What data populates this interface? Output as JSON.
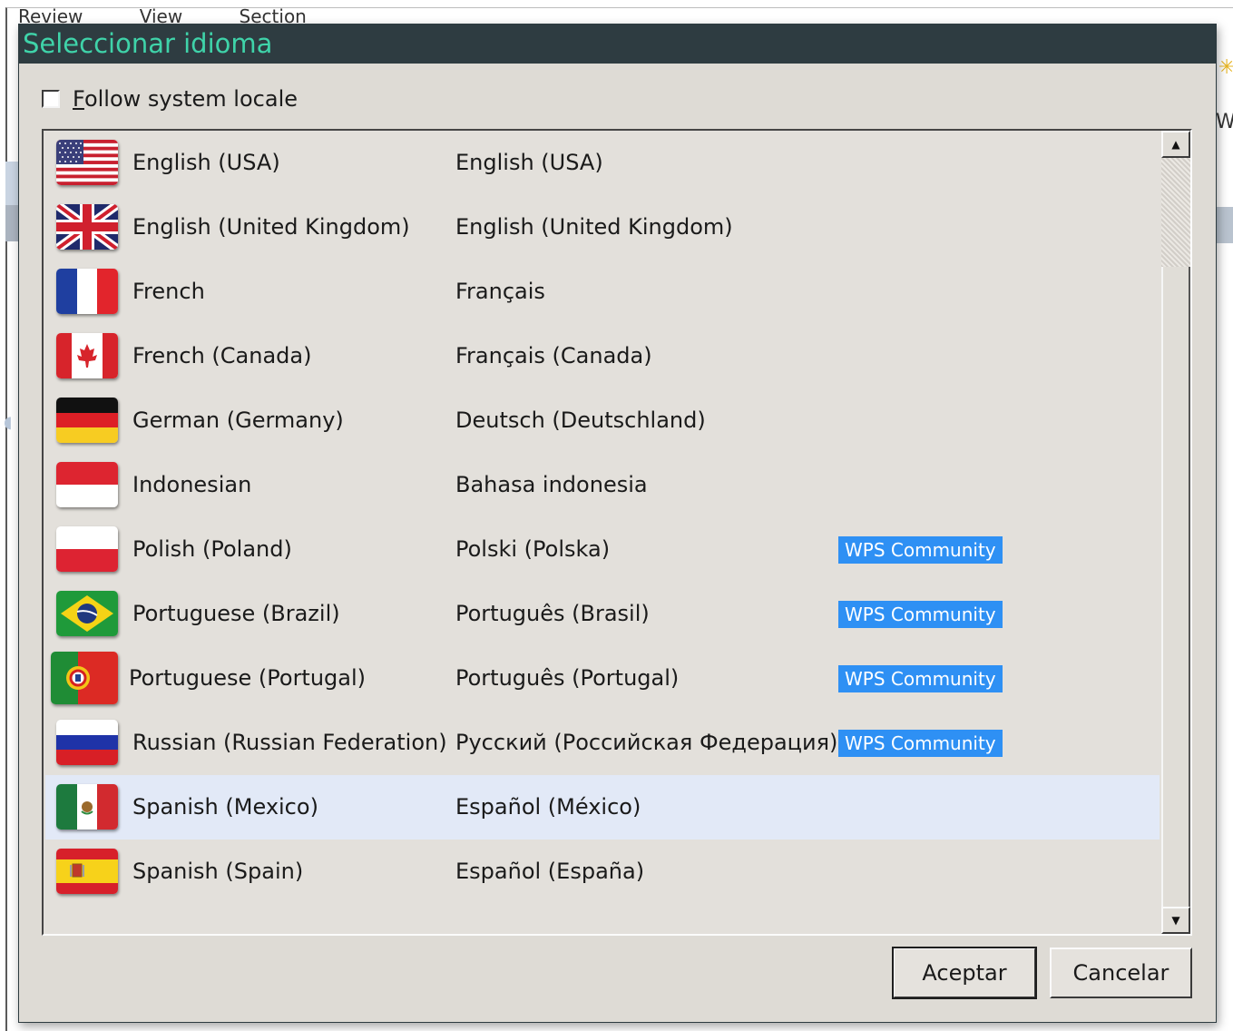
{
  "background": {
    "menu": [
      "Review",
      "View",
      "Section"
    ],
    "right_letter": "W"
  },
  "dialog": {
    "title": "Seleccionar idioma",
    "follow_locale": {
      "label_key": "F",
      "label_rest": "ollow system locale",
      "checked": false
    },
    "languages": [
      {
        "flag": "flag-usa-icon",
        "english_name": "English (USA)",
        "native_name": "English (USA)",
        "badge": ""
      },
      {
        "flag": "flag-uk-icon",
        "english_name": "English (United Kingdom)",
        "native_name": "English (United Kingdom)",
        "badge": ""
      },
      {
        "flag": "flag-france-icon",
        "english_name": "French",
        "native_name": "Français",
        "badge": ""
      },
      {
        "flag": "flag-canada-icon",
        "english_name": "French (Canada)",
        "native_name": "Français (Canada)",
        "badge": ""
      },
      {
        "flag": "flag-germany-icon",
        "english_name": "German (Germany)",
        "native_name": "Deutsch (Deutschland)",
        "badge": ""
      },
      {
        "flag": "flag-indonesia-icon",
        "english_name": "Indonesian",
        "native_name": "Bahasa indonesia",
        "badge": ""
      },
      {
        "flag": "flag-poland-icon",
        "english_name": "Polish (Poland)",
        "native_name": "Polski (Polska)",
        "badge": "WPS Community"
      },
      {
        "flag": "flag-brazil-icon",
        "english_name": "Portuguese (Brazil)",
        "native_name": "Português (Brasil)",
        "badge": "WPS Community"
      },
      {
        "flag": "flag-portugal-icon",
        "english_name": "Portuguese (Portugal)",
        "native_name": "Português (Portugal)",
        "badge": "WPS Community"
      },
      {
        "flag": "flag-russia-icon",
        "english_name": "Russian (Russian Federation)",
        "native_name": "Русский (Российская Федерация)",
        "badge": "WPS Community"
      },
      {
        "flag": "flag-mexico-icon",
        "english_name": "Spanish (Mexico)",
        "native_name": "Español (México)",
        "badge": "",
        "selected": true
      },
      {
        "flag": "flag-spain-icon",
        "english_name": "Spanish (Spain)",
        "native_name": "Español (España)",
        "badge": ""
      }
    ],
    "buttons": {
      "ok": "Aceptar",
      "cancel": "Cancelar"
    }
  },
  "colors": {
    "title_bar_bg": "#2e3c41",
    "title_text": "#3fd3a9",
    "dialog_bg": "#dedbd5",
    "badge_bg": "#2e90f4",
    "selected_row_bg": "#e2e9f7"
  }
}
